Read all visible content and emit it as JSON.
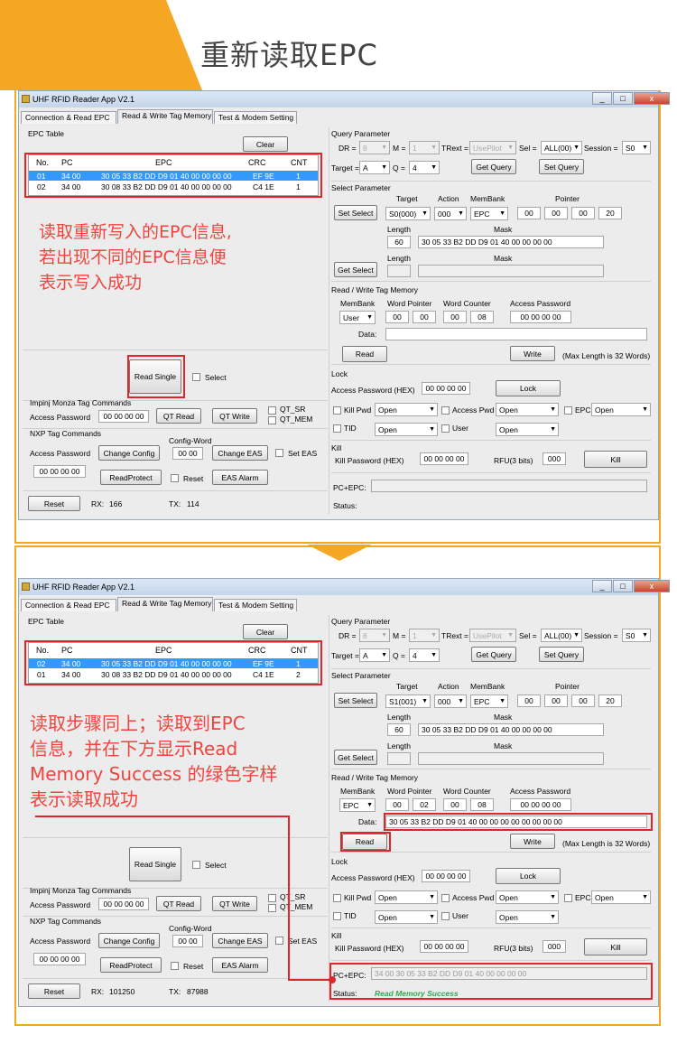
{
  "banner": {
    "title": "重新读取EPC"
  },
  "app": {
    "title": "UHF RFID Reader App V2.1",
    "tabs": [
      "Connection & Read EPC",
      "Read & Write Tag Memory",
      "Test & Modem Setting"
    ],
    "window_controls": {
      "min": "_",
      "max": "□",
      "close": "x"
    }
  },
  "labels": {
    "epc_table": "EPC Table",
    "clear": "Clear",
    "col_no": "No.",
    "col_pc": "PC",
    "col_epc": "EPC",
    "col_crc": "CRC",
    "col_cnt": "CNT",
    "read_single": "Read Single",
    "select": "Select",
    "impinj": "Impinj Monza Tag Commands",
    "access_password": "Access Password",
    "qt_read": "QT Read",
    "qt_write": "QT Write",
    "qt_sr": "QT_SR",
    "qt_mem": "QT_MEM",
    "nxp": "NXP Tag Commands",
    "config_word": "Config-Word",
    "change_config": "Change Config",
    "change_eas": "Change EAS",
    "set_eas": "Set EAS",
    "read_protect": "ReadProtect",
    "reset": "Reset",
    "eas_alarm": "EAS Alarm",
    "rx": "RX:",
    "tx": "TX:",
    "query_param": "Query Parameter",
    "dr": "DR =",
    "m": "M =",
    "trext": "TRext =",
    "sel": "Sel =",
    "session": "Session =",
    "target": "Target =",
    "q": "Q =",
    "get_query": "Get Query",
    "set_query": "Set Query",
    "select_param": "Select Parameter",
    "target_h": "Target",
    "action_h": "Action",
    "membank_h": "MemBank",
    "pointer_h": "Pointer",
    "set_select": "Set Select",
    "length": "Length",
    "mask": "Mask",
    "get_select": "Get Select",
    "rw_memory": "Read / Write Tag Memory",
    "membank": "MemBank",
    "word_pointer": "Word Pointer",
    "word_counter": "Word Counter",
    "access_password_h": "Access Password",
    "data": "Data:",
    "read": "Read",
    "write": "Write",
    "max_len": "(Max Length is 32 Words)",
    "lock": "Lock",
    "access_password_hex": "Access Password (HEX)",
    "lock_btn": "Lock",
    "kill_pwd": "Kill Pwd",
    "access_pwd": "Access Pwd",
    "epc": "EPC",
    "tid": "TID",
    "user": "User",
    "kill": "Kill",
    "kill_password_hex": "Kill Password (HEX)",
    "rfu": "RFU(3 bits)",
    "kill_btn": "Kill",
    "pc_epc": "PC+EPC:",
    "status": "Status:"
  },
  "panel1": {
    "rows": [
      {
        "no": "01",
        "pc": "34 00",
        "epc": "30 05 33 B2 DD D9 01 40 00 00 00 00",
        "crc": "EF 9E",
        "cnt": "1"
      },
      {
        "no": "02",
        "pc": "34 00",
        "epc": "30 08 33 B2 DD D9 01 40 00 00 00 00",
        "crc": "C4 1E",
        "cnt": "1"
      }
    ],
    "annotation": [
      "读取重新写入的EPC信息,",
      "若出现不同的EPC信息便",
      "表示写入成功"
    ],
    "access_password": "00 00 00 00",
    "config_word": "00 00",
    "nxp_password": "00 00 00 00",
    "rx": "166",
    "tx": "114",
    "dr": "8",
    "m": "1",
    "trext": "UsePilot",
    "sel": "ALL(00)",
    "session": "S0",
    "target": "A",
    "q": "4",
    "sel_target": "S0(000)",
    "sel_action": "000",
    "sel_membank": "EPC",
    "pointer": [
      "00",
      "00",
      "00",
      "20"
    ],
    "length": "60",
    "mask": "30 05 33 B2 DD D9 01 40 00 00 00 00",
    "rw_membank": "User",
    "word_pointer": [
      "00",
      "00"
    ],
    "word_counter": [
      "00",
      "08"
    ],
    "rw_password": "00 00 00 00",
    "data": "",
    "lock_password": "00 00 00 00",
    "kill_pwd": "Open",
    "access_pwd": "Open",
    "epc_lock": "Open",
    "tid_lock": "Open",
    "user_lock": "Open",
    "kill_password": "00 00 00 00",
    "rfu": "000",
    "pc_epc": "",
    "status": ""
  },
  "panel2": {
    "rows": [
      {
        "no": "02",
        "pc": "34 00",
        "epc": "30 05 33 B2 DD D9 01 40 00 00 00 00",
        "crc": "EF 9E",
        "cnt": "1"
      },
      {
        "no": "01",
        "pc": "34 00",
        "epc": "30 08 33 B2 DD D9 01 40 00 00 00 00",
        "crc": "C4 1E",
        "cnt": "2"
      }
    ],
    "annotation": [
      "读取步骤同上；读取到EPC",
      "信息，并在下方显示Read",
      "Memory Success 的绿色字样",
      "表示读取成功"
    ],
    "access_password": "00 00 00 00",
    "config_word": "00 00",
    "nxp_password": "00 00 00 00",
    "rx": "101250",
    "tx": "87988",
    "dr": "8",
    "m": "1",
    "trext": "UsePilot",
    "sel": "ALL(00)",
    "session": "S0",
    "target": "A",
    "q": "4",
    "sel_target": "S1(001)",
    "sel_action": "000",
    "sel_membank": "EPC",
    "pointer": [
      "00",
      "00",
      "00",
      "20"
    ],
    "length": "60",
    "mask": "30 05 33 B2 DD D9 01 40 00 00 00 00",
    "rw_membank": "EPC",
    "word_pointer": [
      "00",
      "02"
    ],
    "word_counter": [
      "00",
      "08"
    ],
    "rw_password": "00 00 00 00",
    "data": "30  05  33  B2  DD  D9  01  40  00  00  00  00  00  00  00  00",
    "lock_password": "00 00 00 00",
    "kill_pwd": "Open",
    "access_pwd": "Open",
    "epc_lock": "Open",
    "tid_lock": "Open",
    "user_lock": "Open",
    "kill_password": "00 00 00 00",
    "rfu": "000",
    "pc_epc": "34 00 30 05 33 B2 DD D9 01 40 00 00 00 00",
    "status": "Read Memory Success"
  },
  "colors": {
    "accent": "#f5a623",
    "annotation": "#f0453f",
    "highlight_box": "#e0262a",
    "selection": "#3399ff",
    "success": "#2fa84f"
  }
}
